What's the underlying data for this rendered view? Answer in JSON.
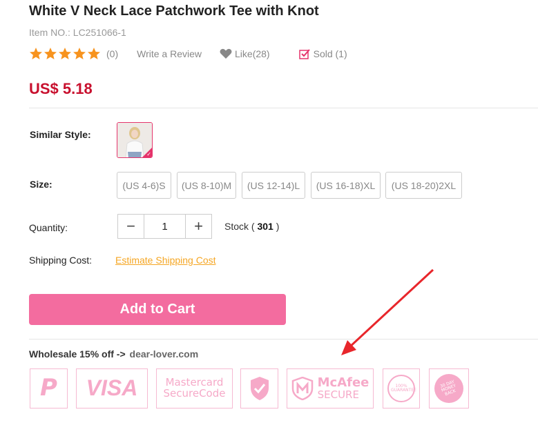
{
  "product": {
    "title": "White V Neck Lace Patchwork Tee with Knot",
    "item_no": "Item NO.: LC251066-1",
    "review_count": "(0)",
    "write_review": "Write a Review",
    "like": "Like(28)",
    "sold": "Sold (1)",
    "price": "US$ 5.18"
  },
  "similar": {
    "label": "Similar Style:"
  },
  "size": {
    "label": "Size:",
    "options": [
      "(US 4-6)S",
      "(US 8-10)M",
      "(US 12-14)L",
      "(US 16-18)XL",
      "(US 18-20)2XL"
    ]
  },
  "quantity": {
    "label": "Quantity:",
    "minus": "−",
    "value": "1",
    "plus": "+",
    "stock_prefix": "Stock (",
    "stock_value": "301",
    "stock_suffix": ")"
  },
  "shipping": {
    "label": "Shipping Cost:",
    "link": "Estimate Shipping Cost"
  },
  "cart": {
    "label": "Add to Cart"
  },
  "wholesale": {
    "text": "Wholesale 15% off ->",
    "site": "dear-lover.com"
  },
  "badges": {
    "paypal": "P",
    "visa": "VISA",
    "mastercard_line1": "Mastercard",
    "mastercard_line2": "SecureCode",
    "mcafee_line1": "McAfee",
    "mcafee_line2": "SECURE",
    "guarantee": "100% GUARANTEE",
    "moneyback": "30 DAY MONEY BACK"
  },
  "colors": {
    "accent": "#f36c9f",
    "price": "#c8102e",
    "star": "#f7931e",
    "link": "#f5a623",
    "annotation_arrow": "#e8262b"
  },
  "icons": [
    "star-icon",
    "heart-icon",
    "sold-check-icon",
    "paypal-icon",
    "visa-icon",
    "mastercard-securecode-icon",
    "shield-check-icon",
    "mcafee-secure-icon",
    "guarantee-icon",
    "money-back-icon",
    "annotation-arrow"
  ]
}
